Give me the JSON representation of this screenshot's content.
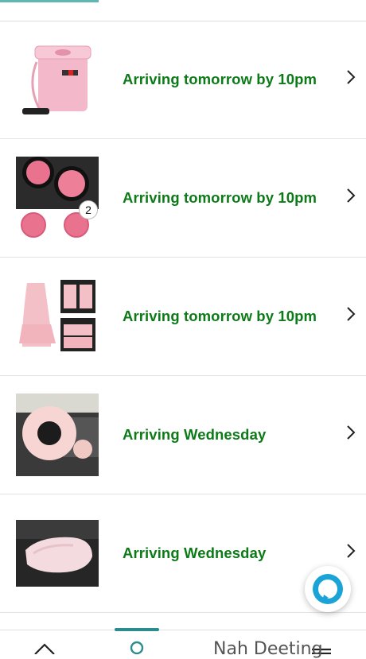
{
  "orders": [
    {
      "status": "Arriving tomorrow by 10pm",
      "thumb": "pink-car-trash-can"
    },
    {
      "status": "Arriving tomorrow by 10pm",
      "thumb": "pink-cup-coasters",
      "badge": "2"
    },
    {
      "status": "Arriving tomorrow by 10pm",
      "thumb": "pink-seat-covers"
    },
    {
      "status": "Arriving Wednesday",
      "thumb": "pink-fluffy-steering-cover"
    },
    {
      "status": "Arriving Wednesday",
      "thumb": "pink-fluffy-armrest-cover"
    }
  ],
  "bottom_nav": {
    "overlay_text": "Nah Deeting",
    "icons": [
      "home-icon",
      "account-icon",
      "cart-icon",
      "menu-icon"
    ]
  },
  "colors": {
    "status_green": "#0b7a17",
    "accent_teal": "#2a8c8c",
    "alexa_blue": "#1aa3d6"
  }
}
